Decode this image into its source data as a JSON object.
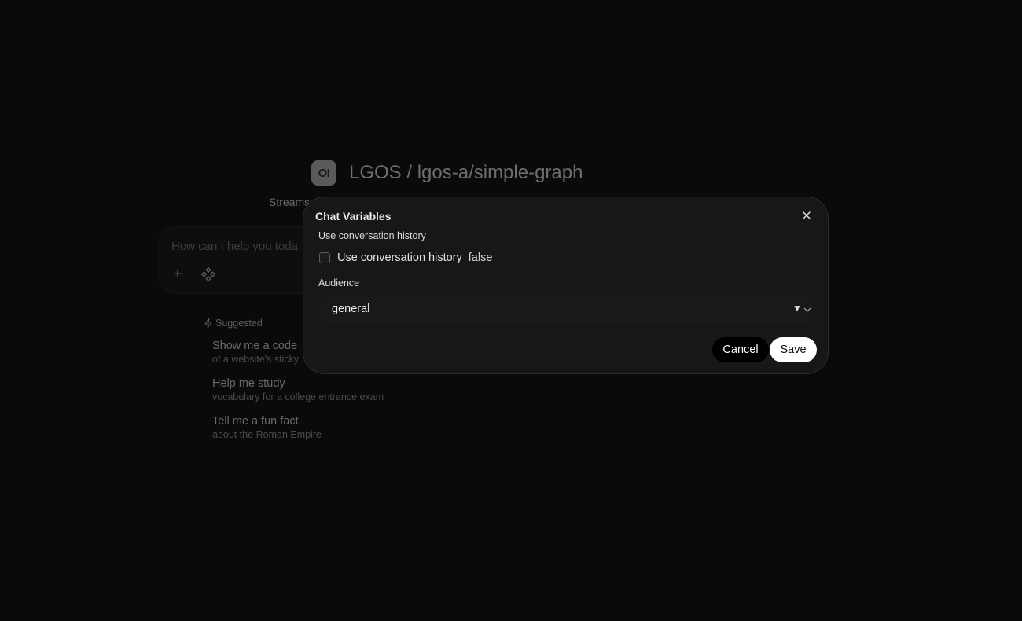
{
  "app": {
    "logo_text": "OI",
    "title": "LGOS / lgos-a/simple-graph",
    "subtitle": "Streams"
  },
  "chat": {
    "placeholder": "How can I help you toda",
    "plus_icon": "plus-icon",
    "tools_icon": "integrations-icon"
  },
  "suggested": {
    "heading": "Suggested",
    "items": [
      {
        "title": "Show me a code",
        "subtitle": "of a website's sticky"
      },
      {
        "title": "Help me study",
        "subtitle": "vocabulary for a college entrance exam"
      },
      {
        "title": "Tell me a fun fact",
        "subtitle": "about the Roman Empire"
      }
    ]
  },
  "modal": {
    "title": "Chat Variables",
    "fields": {
      "history": {
        "label": "Use conversation history",
        "checkbox_label": "Use conversation history",
        "value": "false",
        "checked": false
      },
      "audience": {
        "label": "Audience",
        "value": "general"
      }
    },
    "buttons": {
      "cancel": "Cancel",
      "save": "Save"
    }
  },
  "colors": {
    "background": "#0a0a0a",
    "modal_bg": "#171717",
    "save_bg": "#ffffff",
    "cancel_bg": "#000000"
  }
}
